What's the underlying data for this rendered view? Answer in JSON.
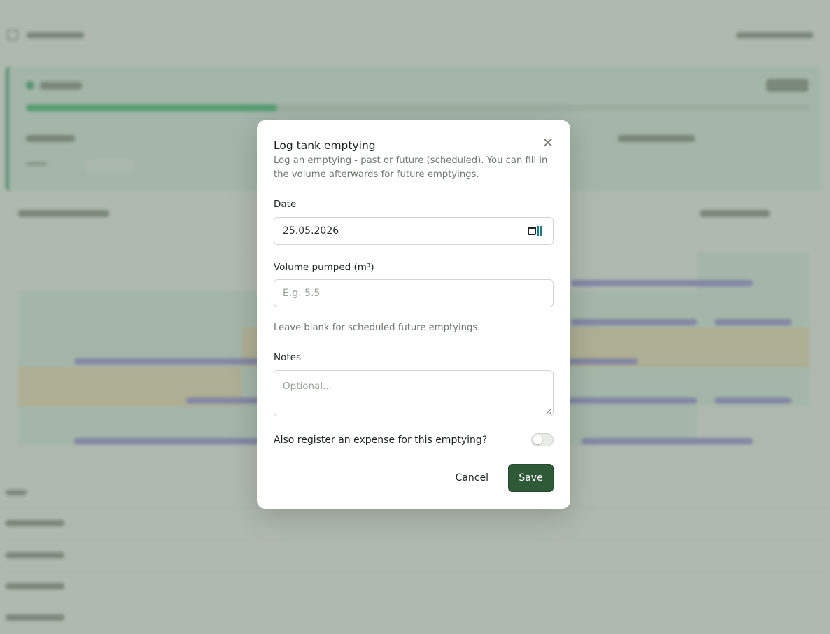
{
  "modal": {
    "title": "Log tank emptying",
    "description": "Log an emptying - past or future (scheduled). You can fill in the volume afterwards for future emptyings.",
    "date": {
      "label": "Date",
      "value": "25.05.2026"
    },
    "volume": {
      "label": "Volume pumped (m³)",
      "placeholder": "E.g. 5.5",
      "hint": "Leave blank for scheduled future emptyings."
    },
    "notes": {
      "label": "Notes",
      "placeholder": "Optional..."
    },
    "expense_toggle": {
      "label": "Also register an expense for this emptying?",
      "on": false
    },
    "cancel_label": "Cancel",
    "save_label": "Save",
    "close_icon": "close-icon",
    "calendar_icon": "calendar-icon"
  },
  "colors": {
    "primary": "#2f5a38",
    "accent_green": "#2fb56a",
    "event_purple": "#8f86d6",
    "warning_yellow": "#efe0b2"
  }
}
